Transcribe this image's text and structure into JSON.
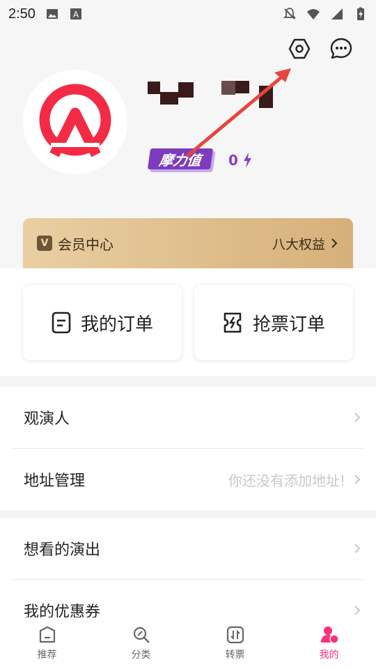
{
  "status_bar": {
    "time": "2:50",
    "left_icons": [
      "image-icon",
      "text-a-icon"
    ],
    "right_icons": [
      "bell-off-icon",
      "wifi-icon",
      "signal-icon",
      "battery-charging-icon"
    ]
  },
  "header": {
    "settings_icon": "settings-hex-icon",
    "message_icon": "message-dots-icon",
    "badge_label": "摩力值",
    "points_value": "0",
    "accent_purple": "#8b3fd0",
    "accent_pink": "#ff2e7a"
  },
  "member": {
    "badge": "V",
    "title": "会员中心",
    "action": "八大权益"
  },
  "orders": {
    "my_orders": "我的订单",
    "grab_orders": "抢票订单"
  },
  "section1": {
    "rows": [
      {
        "label": "观演人",
        "hint": ""
      },
      {
        "label": "地址管理",
        "hint": "你还没有添加地址!"
      }
    ]
  },
  "section2": {
    "rows": [
      {
        "label": "想看的演出",
        "hint": ""
      },
      {
        "label": "我的优惠券",
        "hint": ""
      }
    ]
  },
  "tabs": [
    {
      "label": "推荐",
      "icon": "home-icon",
      "active": false
    },
    {
      "label": "分类",
      "icon": "search-category-icon",
      "active": false
    },
    {
      "label": "转票",
      "icon": "transfer-ticket-icon",
      "active": false
    },
    {
      "label": "我的",
      "icon": "profile-icon",
      "active": true
    }
  ]
}
